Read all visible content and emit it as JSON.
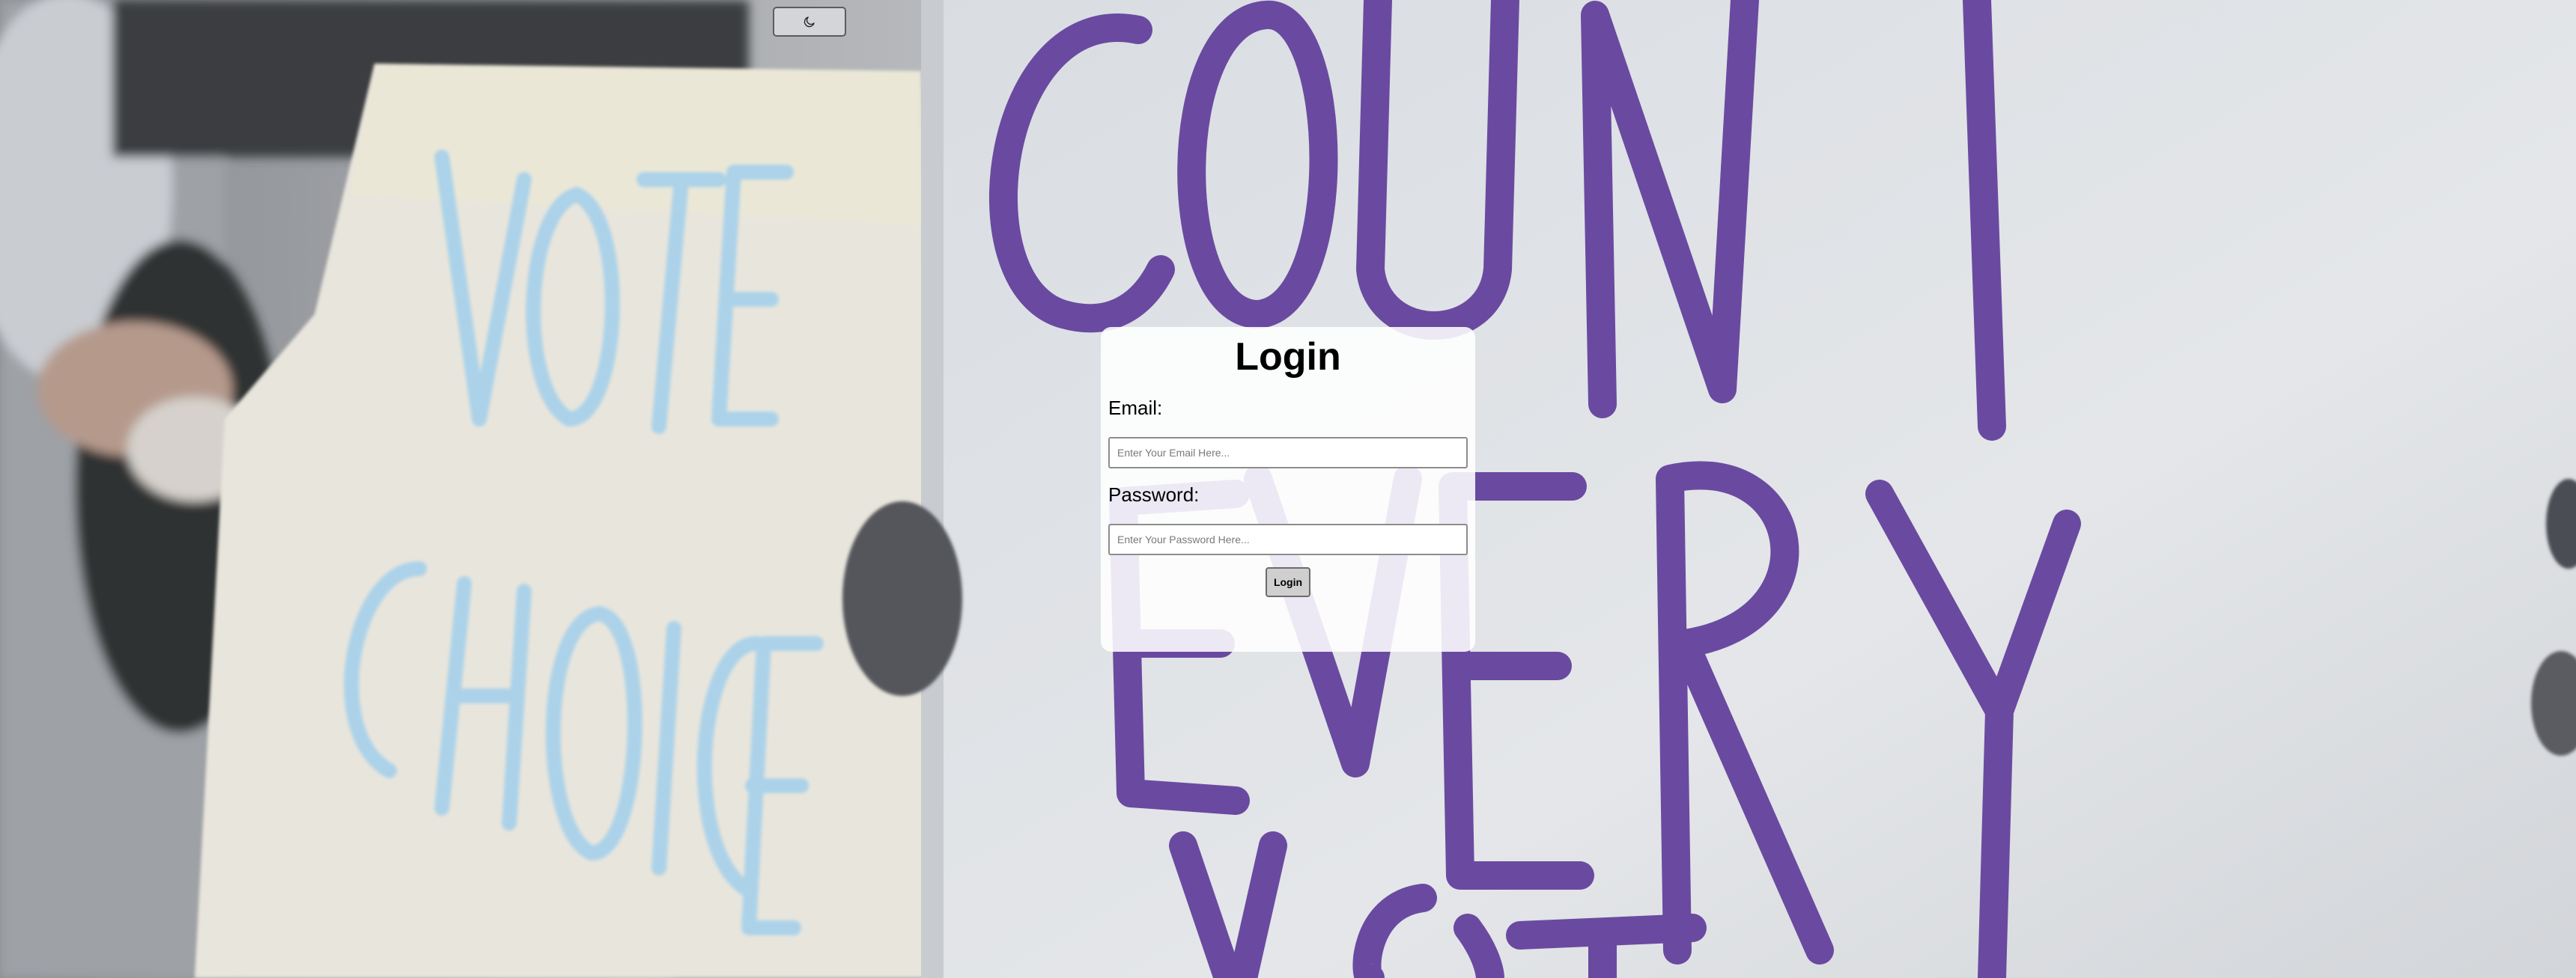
{
  "theme_toggle": {
    "icon": "moon-icon"
  },
  "login_form": {
    "title": "Login",
    "email_label": "Email:",
    "email_placeholder": "Enter Your Email Here...",
    "password_label": "Password:",
    "password_placeholder": "Enter Your Password Here...",
    "submit_label": "Login"
  },
  "colors": {
    "sign_text_purple": "#6a4aa0",
    "sign_text_blue": "#a9d2ea",
    "card_background": "#ffffff"
  },
  "background": {
    "sign_text_left": "VOTE CHOICE",
    "sign_text_right": "COUNT EVERY VOTE"
  }
}
